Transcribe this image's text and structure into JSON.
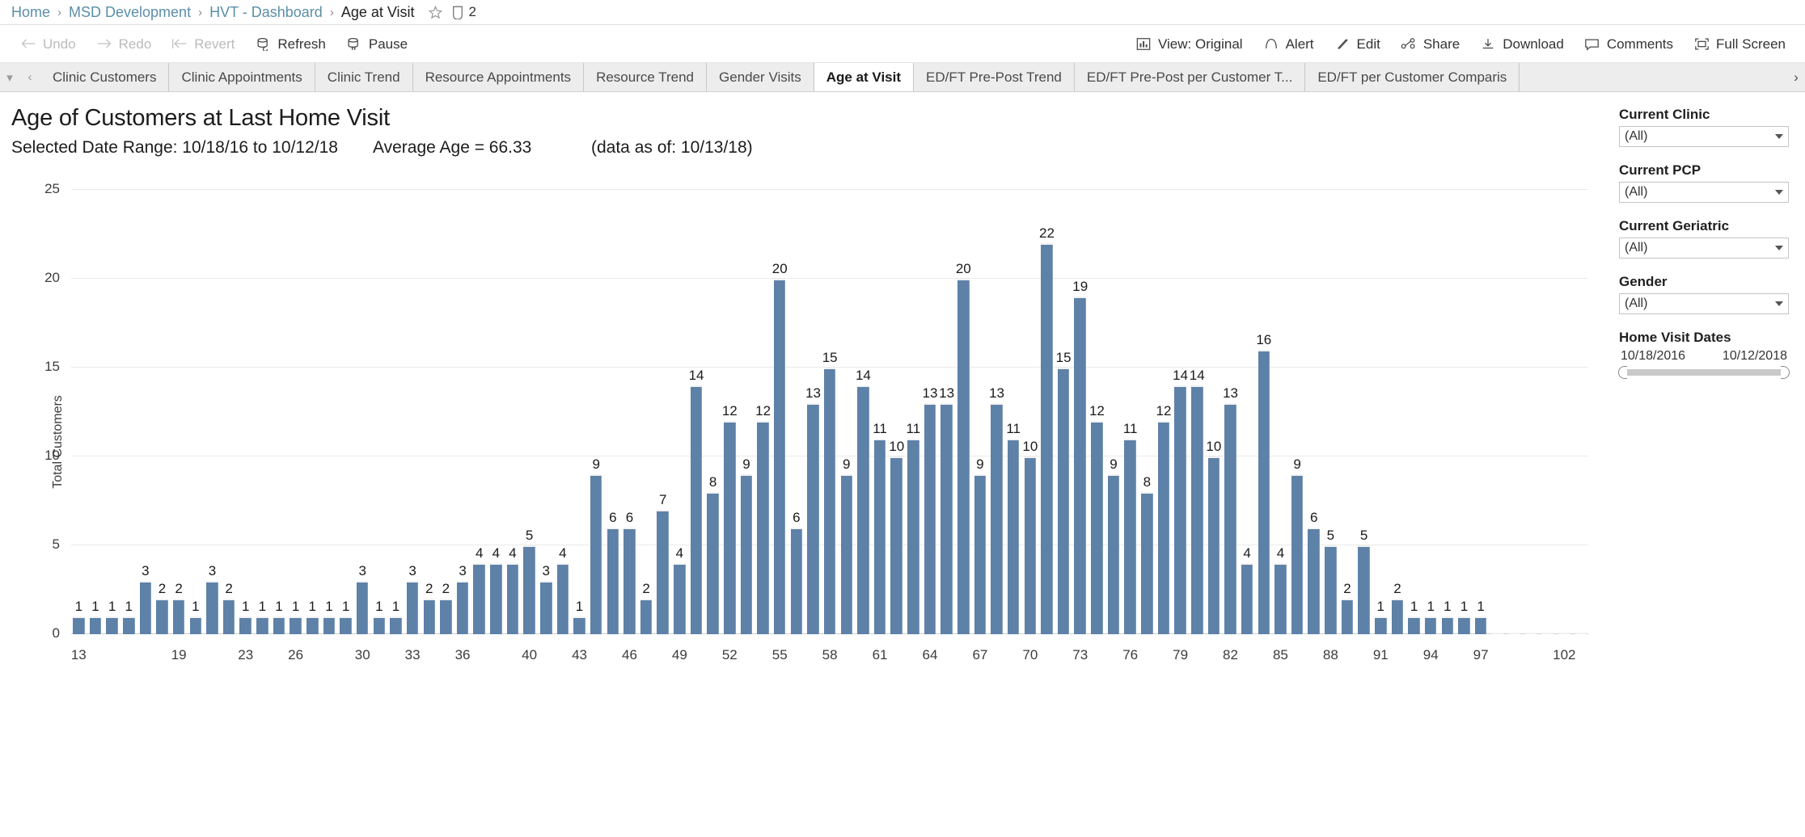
{
  "breadcrumb": {
    "items": [
      {
        "label": "Home",
        "type": "link"
      },
      {
        "label": "MSD Development",
        "type": "link"
      },
      {
        "label": "HVT - Dashboard",
        "type": "link"
      },
      {
        "label": "Age at Visit",
        "type": "current"
      }
    ],
    "separator": "›",
    "views_count": "2"
  },
  "toolbar": {
    "left": [
      {
        "label": "Undo",
        "icon": "undo-arrow-icon",
        "disabled": true
      },
      {
        "label": "Redo",
        "icon": "redo-arrow-icon",
        "disabled": true
      },
      {
        "label": "Revert",
        "icon": "revert-arrow-icon",
        "disabled": true
      },
      {
        "label": "Refresh",
        "icon": "refresh-icon",
        "disabled": false
      },
      {
        "label": "Pause",
        "icon": "pause-icon",
        "disabled": false
      }
    ],
    "right": [
      {
        "label": "View: Original",
        "icon": "view-chart-icon"
      },
      {
        "label": "Alert",
        "icon": "alert-bell-icon"
      },
      {
        "label": "Edit",
        "icon": "edit-pencil-icon"
      },
      {
        "label": "Share",
        "icon": "share-nodes-icon"
      },
      {
        "label": "Download",
        "icon": "download-arrow-icon"
      },
      {
        "label": "Comments",
        "icon": "comment-bubble-icon"
      },
      {
        "label": "Full Screen",
        "icon": "fullscreen-icon"
      }
    ]
  },
  "tabs": {
    "prev_label": "‹",
    "next_label": "›",
    "menu_label": "▾",
    "items": [
      {
        "label": "Clinic Customers",
        "active": false
      },
      {
        "label": "Clinic Appointments",
        "active": false
      },
      {
        "label": "Clinic Trend",
        "active": false
      },
      {
        "label": "Resource Appointments",
        "active": false
      },
      {
        "label": "Resource Trend",
        "active": false
      },
      {
        "label": "Gender Visits",
        "active": false
      },
      {
        "label": "Age at Visit",
        "active": true
      },
      {
        "label": "ED/FT Pre-Post Trend",
        "active": false
      },
      {
        "label": "ED/FT Pre-Post per Customer T...",
        "active": false
      },
      {
        "label": "ED/FT per Customer Comparis",
        "active": false
      }
    ]
  },
  "view": {
    "title": "Age of Customers at Last Home Visit",
    "date_range": "Selected Date Range: 10/18/16 to 10/12/18",
    "average_age": "Average Age = 66.33",
    "data_as_of": "(data as of: 10/13/18)"
  },
  "filters": [
    {
      "label": "Current Clinic",
      "value": "(All)"
    },
    {
      "label": "Current PCP",
      "value": "(All)"
    },
    {
      "label": "Current Geriatric",
      "value": "(All)"
    },
    {
      "label": "Gender",
      "value": "(All)"
    }
  ],
  "date_slider": {
    "label": "Home Visit Dates",
    "start": "10/18/2016",
    "end": "10/12/2018"
  },
  "colors": {
    "bar": "#5e81a8",
    "grid": "#eaeaea",
    "link": "#5b8fa8",
    "tab_active_bg": "#ffffff",
    "tab_bg": "#ededed"
  },
  "chart_data": {
    "type": "bar",
    "title": "Age of Customers at Last Home Visit",
    "xlabel": "",
    "ylabel": "Total Customers",
    "ylim": [
      0,
      25
    ],
    "yticks": [
      0,
      5,
      10,
      15,
      20,
      25
    ],
    "grid": true,
    "legend": "none",
    "xtick_labels": [
      "13",
      "19",
      "23",
      "26",
      "30",
      "33",
      "36",
      "40",
      "43",
      "46",
      "49",
      "52",
      "55",
      "58",
      "61",
      "64",
      "67",
      "70",
      "73",
      "76",
      "79",
      "82",
      "85",
      "88",
      "91",
      "94",
      "97",
      "102"
    ],
    "categories": [
      "13",
      "14",
      "15",
      "16",
      "17",
      "18",
      "19",
      "20",
      "21",
      "22",
      "23",
      "24",
      "25",
      "26",
      "27",
      "28",
      "29",
      "30",
      "31",
      "32",
      "33",
      "34",
      "35",
      "36",
      "37",
      "38",
      "39",
      "40",
      "41",
      "42",
      "43",
      "44",
      "45",
      "46",
      "47",
      "48",
      "49",
      "50",
      "51",
      "52",
      "53",
      "54",
      "55",
      "56",
      "57",
      "58",
      "59",
      "60",
      "61",
      "62",
      "63",
      "64",
      "65",
      "66",
      "67",
      "68",
      "69",
      "70",
      "71",
      "72",
      "73",
      "74",
      "75",
      "76",
      "77",
      "78",
      "79",
      "80",
      "81",
      "82",
      "83",
      "84",
      "85",
      "86",
      "87",
      "88",
      "89",
      "90",
      "91",
      "92",
      "93",
      "94",
      "95",
      "96",
      "97",
      "98",
      "99",
      "100",
      "101",
      "102",
      "103"
    ],
    "values": [
      1,
      1,
      1,
      1,
      3,
      2,
      2,
      1,
      3,
      2,
      1,
      1,
      1,
      1,
      1,
      1,
      1,
      3,
      1,
      1,
      3,
      2,
      2,
      3,
      4,
      4,
      4,
      5,
      3,
      4,
      1,
      9,
      6,
      6,
      2,
      7,
      4,
      14,
      8,
      12,
      9,
      12,
      20,
      6,
      13,
      15,
      9,
      14,
      11,
      10,
      11,
      13,
      13,
      20,
      9,
      13,
      11,
      10,
      22,
      15,
      19,
      12,
      9,
      11,
      8,
      12,
      14,
      14,
      10,
      13,
      4,
      16,
      4,
      9,
      6,
      5,
      2,
      5,
      1,
      2,
      1,
      1,
      1,
      1,
      1
    ],
    "value_labels_shown": true
  }
}
